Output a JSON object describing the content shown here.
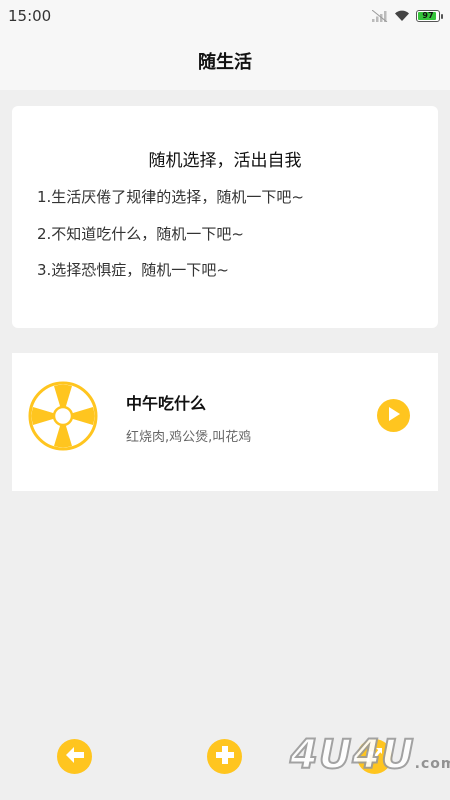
{
  "status_bar": {
    "time": "15:00",
    "battery_level": "97",
    "icons": [
      "signal-icon",
      "wifi-icon",
      "battery-icon"
    ]
  },
  "app_bar": {
    "title": "随生活"
  },
  "intro": {
    "heading": "随机选择，活出自我",
    "lines": [
      "1.生活厌倦了规律的选择，随机一下吧~",
      "2.不知道吃什么，随机一下吧~",
      "3.选择恐惧症，随机一下吧~"
    ]
  },
  "topics": [
    {
      "title": "中午吃什么",
      "options": "红烧肉,鸡公煲,叫花鸡",
      "icon": "wheel-icon",
      "action_icon": "play-icon"
    }
  ],
  "bottom_bar": {
    "buttons": [
      "back-arrow-icon",
      "add-icon",
      "share-icon"
    ]
  },
  "watermark": {
    "text": "4U4U",
    "suffix": ".com"
  },
  "colors": {
    "accent": "#ffc51f",
    "background": "#efefef",
    "card": "#ffffff",
    "battery": "#35c43a"
  }
}
